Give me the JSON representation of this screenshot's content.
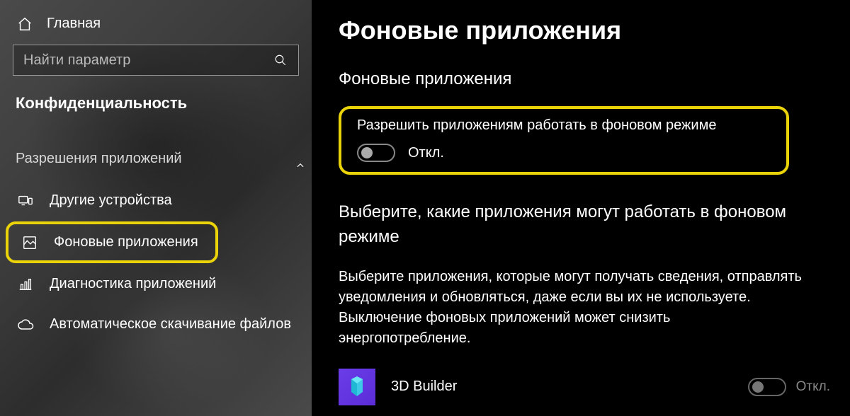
{
  "sidebar": {
    "home_label": "Главная",
    "search_placeholder": "Найти параметр",
    "category": "Конфиденциальность",
    "section_heading": "Разрешения приложений",
    "items": [
      {
        "label": "Другие устройства"
      },
      {
        "label": "Фоновые приложения"
      },
      {
        "label": "Диагностика приложений"
      },
      {
        "label": "Автоматическое скачивание файлов"
      }
    ]
  },
  "main": {
    "title": "Фоновые приложения",
    "section1_heading": "Фоновые приложения",
    "background_toggle": {
      "label": "Разрешить приложениям работать в фоновом режиме",
      "state": "Откл."
    },
    "section2_heading": "Выберите, какие приложения могут работать в фоновом режиме",
    "description": "Выберите приложения, которые могут получать сведения, отправлять уведомления и обновляться, даже если вы их не используете. Выключение фоновых приложений может снизить энергопотребление.",
    "apps": [
      {
        "name": "3D Builder",
        "state": "Откл."
      }
    ]
  },
  "colors": {
    "highlight": "#ead308"
  }
}
